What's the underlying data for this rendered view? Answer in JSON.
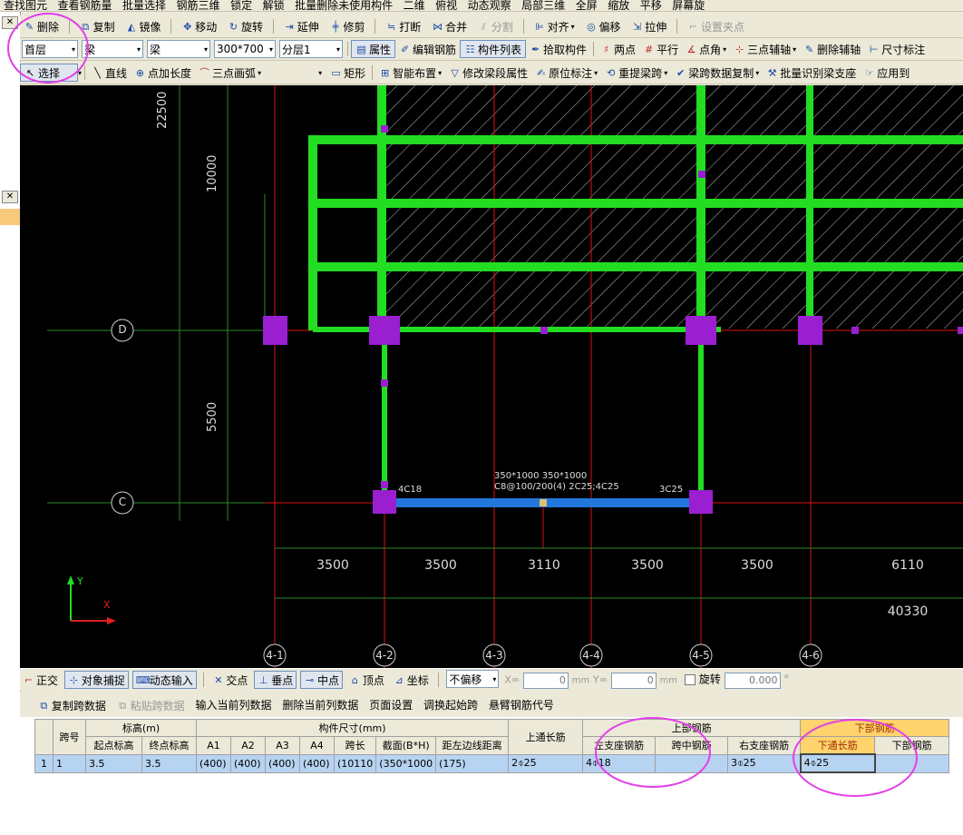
{
  "toolbar_top": [
    "查找图元",
    "查看钢筋量",
    "批量选择",
    "钢筋三维",
    "锁定",
    "解锁",
    "批量删除未使用构件",
    "二维",
    "俯视",
    "动态观察",
    "局部三维",
    "全屏",
    "缩放",
    "平移",
    "屏幕旋"
  ],
  "toolbar1": {
    "items": [
      "删除",
      "复制",
      "镜像",
      "移动",
      "旋转",
      "延伸",
      "修剪",
      "打断",
      "合并",
      "分割",
      "对齐",
      "偏移",
      "拉伸",
      "设置夹点"
    ]
  },
  "toolbar2": {
    "floor": "首层",
    "category": "梁",
    "type": "梁",
    "component": "300*700",
    "layer": "分层1",
    "items": [
      "属性",
      "编辑钢筋",
      "构件列表",
      "拾取构件",
      "两点",
      "平行",
      "点角",
      "三点辅轴",
      "删除辅轴",
      "尺寸标注"
    ]
  },
  "toolbar3": {
    "items": [
      "选择",
      "直线",
      "点加长度",
      "三点画弧",
      "矩形",
      "智能布置",
      "修改梁段属性",
      "原位标注",
      "重提梁跨",
      "梁跨数据复制",
      "批量识别梁支座",
      "应用到"
    ]
  },
  "canvas": {
    "dims_left": [
      "22500",
      "10000",
      "5500"
    ],
    "axis_rows": [
      "D",
      "C"
    ],
    "axis_cols": [
      "4-1",
      "4-2",
      "4-3",
      "4-4",
      "4-5",
      "4-6"
    ],
    "dims_bottom": [
      "3500",
      "3500",
      "3110",
      "3500",
      "3500",
      "6110"
    ],
    "dim_total": "40330",
    "beam_labels": {
      "left": "4C18",
      "center1": "350*1000 350*1000",
      "center2": "C8@100/200(4) 2C25;4C25",
      "right": "3C25"
    },
    "ucs": {
      "x": "X",
      "y": "Y"
    }
  },
  "statusbar": {
    "items": [
      "正交",
      "对象捕捉",
      "动态输入",
      "交点",
      "垂点",
      "中点",
      "顶点",
      "坐标"
    ],
    "move_mode": "不偏移",
    "x_label": "X=",
    "x_value": "0",
    "y_label": "Y=",
    "y_value": "0",
    "unit": "mm",
    "rotate_label": "旋转",
    "rotate_value": "0.000",
    "degree": "°"
  },
  "panel": {
    "tools": [
      "复制跨数据",
      "粘贴跨数据",
      "输入当前列数据",
      "删除当前列数据",
      "页面设置",
      "调换起始跨",
      "悬臂钢筋代号"
    ],
    "headers": {
      "span_no": "跨号",
      "elevation": "标高(m)",
      "start_elev": "起点标高",
      "end_elev": "终点标高",
      "size": "构件尺寸(mm)",
      "a1": "A1",
      "a2": "A2",
      "a3": "A3",
      "a4": "A4",
      "span_len": "跨长",
      "section": "截面(B*H)",
      "edge_dist": "距左边线距离",
      "top_through": "上通长筋",
      "top_rebar": "上部钢筋",
      "left_support": "左支座钢筋",
      "mid_span": "跨中钢筋",
      "right_support": "右支座钢筋",
      "bottom_rebar": "下部钢筋",
      "bottom_through": "下通长筋",
      "bottom_bar": "下部钢筋"
    },
    "row": {
      "idx": "1",
      "span": "1",
      "start_elev": "3.5",
      "end_elev": "3.5",
      "a1": "(400)",
      "a2": "(400)",
      "a3": "(400)",
      "a4": "(400)",
      "span_len": "(10110",
      "section": "(350*1000",
      "edge_dist": "(175)",
      "top_through": "2⌽25",
      "left_support": "4⌽18",
      "mid_span": "",
      "right_support": "3⌽25",
      "bottom_through": "4⌽25",
      "bottom_bar": ""
    }
  }
}
